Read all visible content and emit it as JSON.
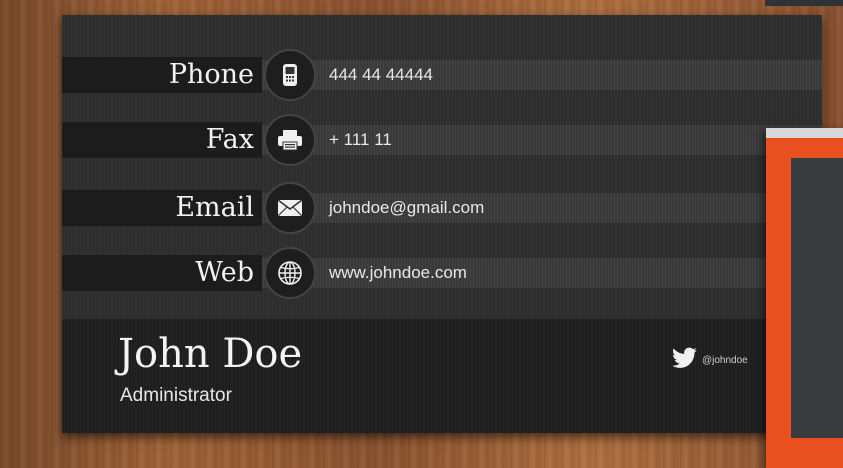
{
  "contact": {
    "phone_label": "Phone",
    "phone_value": "444 44 44444",
    "fax_label": "Fax",
    "fax_value": "+ 111 11",
    "email_label": "Email",
    "email_value": "johndoe@gmail.com",
    "web_label": "Web",
    "web_value": "www.johndoe.com"
  },
  "person": {
    "name": "John Doe",
    "title": "Administrator"
  },
  "social": {
    "twitter_handle": "@johndoe",
    "icon": "twitter-bird-icon"
  },
  "colors": {
    "card_bg": "#2d2d2d",
    "accent_card": "#e8501f",
    "wood": "#9a5e36"
  }
}
